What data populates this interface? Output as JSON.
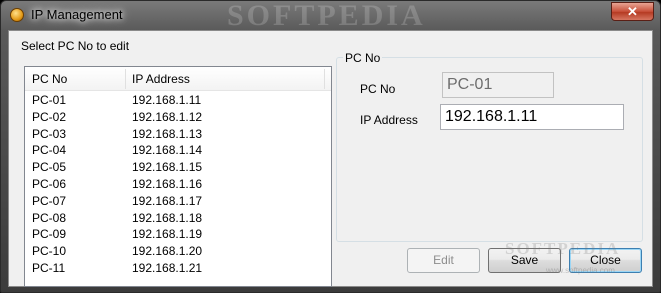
{
  "window": {
    "title": "IP Management",
    "close_glyph": "✕",
    "watermark": "SOFTPEDIA"
  },
  "left_panel": {
    "legend": "Select PC No to edit",
    "columns": [
      "PC No",
      "IP Address"
    ],
    "rows": [
      {
        "pc": "PC-01",
        "ip": "192.168.1.11"
      },
      {
        "pc": "PC-02",
        "ip": "192.168.1.12"
      },
      {
        "pc": "PC-03",
        "ip": "192.168.1.13"
      },
      {
        "pc": "PC-04",
        "ip": "192.168.1.14"
      },
      {
        "pc": "PC-05",
        "ip": "192.168.1.15"
      },
      {
        "pc": "PC-06",
        "ip": "192.168.1.16"
      },
      {
        "pc": "PC-07",
        "ip": "192.168.1.17"
      },
      {
        "pc": "PC-08",
        "ip": "192.168.1.18"
      },
      {
        "pc": "PC-09",
        "ip": "192.168.1.19"
      },
      {
        "pc": "PC-10",
        "ip": "192.168.1.20"
      },
      {
        "pc": "PC-11",
        "ip": "192.168.1.21"
      }
    ]
  },
  "right_panel": {
    "legend": "PC No",
    "pc_no_label": "PC No",
    "pc_no_value": "PC-01",
    "ip_label": "IP Address",
    "ip_value": "192.168.1.11"
  },
  "buttons": {
    "edit": "Edit",
    "save": "Save",
    "close": "Close"
  },
  "watermark_bottom": {
    "text": "SOFTPEDIA",
    "url": "www.softpedia.com"
  },
  "colors": {
    "titlebar": "#595959",
    "client_bg": "#f0f0f0",
    "close_button": "#c8503a"
  }
}
